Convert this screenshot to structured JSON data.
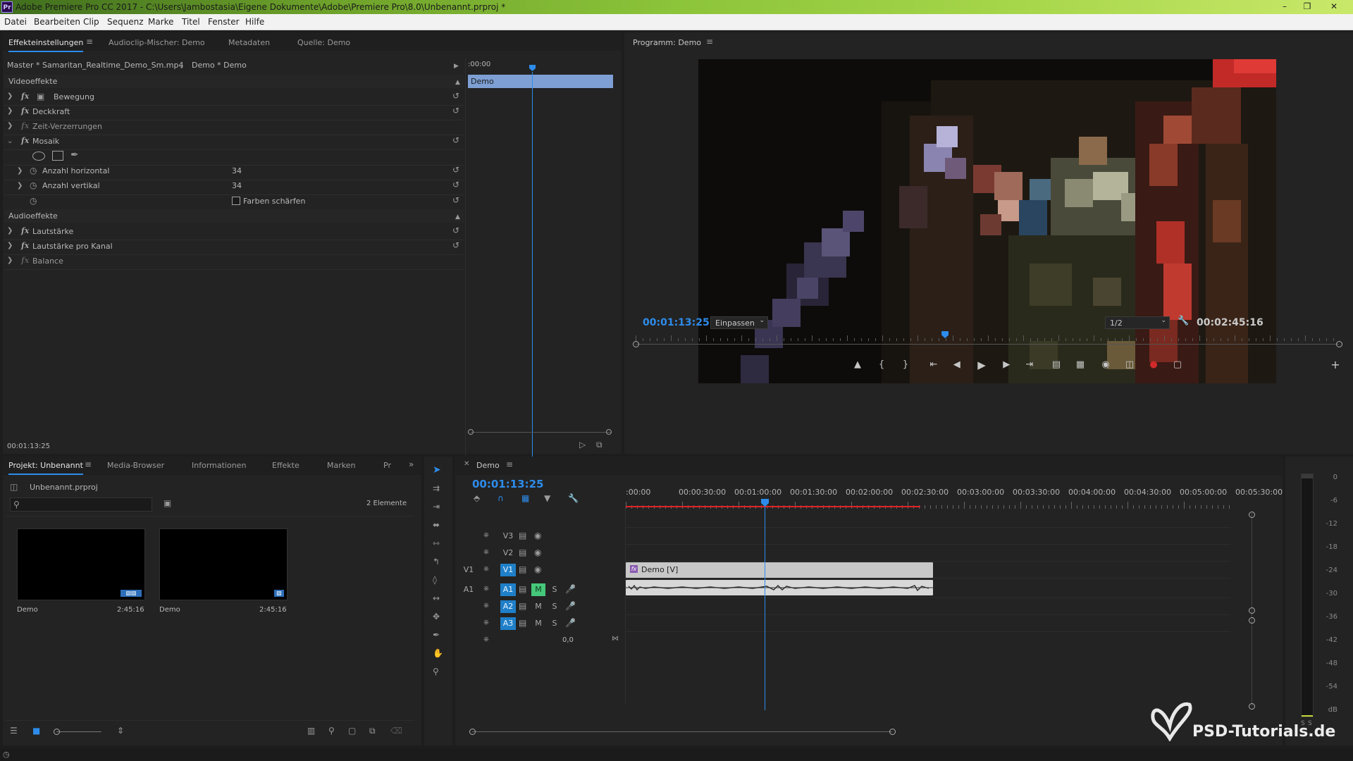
{
  "window": {
    "title": "Adobe Premiere Pro CC 2017 - C:\\Users\\Jambostasia\\Eigene Dokumente\\Adobe\\Premiere Pro\\8.0\\Unbenannt.prproj *",
    "app_logo": "Pr"
  },
  "menu": [
    "Datei",
    "Bearbeiten",
    "Clip",
    "Sequenz",
    "Marke",
    "Titel",
    "Fenster",
    "Hilfe"
  ],
  "effect_panel": {
    "tabs": [
      "Effekteinstellungen",
      "Audioclip-Mischer: Demo",
      "Metadaten",
      "Quelle: Demo"
    ],
    "master_label": "Master * Samaritan_Realtime_Demo_Sm.mp4",
    "sequence_label": "Demo * Demo",
    "mini_timecode": ":00:00",
    "mini_clip": "Demo",
    "video_section": "Videoeffekte",
    "effects": [
      {
        "name": "Bewegung"
      },
      {
        "name": "Deckkraft"
      },
      {
        "name": "Zeit-Verzerrungen"
      },
      {
        "name": "Mosaik"
      }
    ],
    "params": [
      {
        "name": "Anzahl horizontal",
        "value": "34"
      },
      {
        "name": "Anzahl vertikal",
        "value": "34"
      }
    ],
    "checkbox_label": "Farben schärfen",
    "audio_section": "Audioeffekte",
    "audio_effects": [
      {
        "name": "Lautstärke"
      },
      {
        "name": "Lautstärke pro Kanal"
      },
      {
        "name": "Balance"
      }
    ],
    "timecode": "00:01:13:25"
  },
  "program_monitor": {
    "title": "Programm: Demo",
    "timecode": "00:01:13:25",
    "zoom": "Einpassen",
    "resolution": "1/2",
    "duration": "00:02:45:16",
    "playhead_fraction": 0.44
  },
  "project_panel": {
    "tabs": [
      "Projekt: Unbenannt",
      "Media-Browser",
      "Informationen",
      "Effekte",
      "Marken",
      "Pr"
    ],
    "file": "Unbenannt.prproj",
    "item_count": "2 Elemente",
    "items": [
      {
        "name": "Demo",
        "duration": "2:45:16"
      },
      {
        "name": "Demo",
        "duration": "2:45:16"
      }
    ]
  },
  "timeline": {
    "title": "Demo",
    "timecode": "00:01:13:25",
    "ruler": [
      ":00:00",
      "00:00:30:00",
      "00:01:00:00",
      "00:01:30:00",
      "00:02:00:00",
      "00:02:30:00",
      "00:03:00:00",
      "00:03:30:00",
      "00:04:00:00",
      "00:04:30:00",
      "00:05:00:00",
      "00:05:30:00"
    ],
    "video_tracks": [
      "V3",
      "V2",
      "V1"
    ],
    "audio_tracks": [
      "A1",
      "A2",
      "A3"
    ],
    "source_video": "V1",
    "source_audio": "A1",
    "video_clip": "Demo [V]",
    "mute_label": "M",
    "solo_label": "S",
    "master_volume": "0,0"
  },
  "meter": {
    "labels": [
      "0",
      "-6",
      "-12",
      "-18",
      "-24",
      "-30",
      "-36",
      "-42",
      "-48",
      "-54",
      "dB"
    ],
    "bottom": [
      "S",
      "S"
    ]
  },
  "watermark": "PSD-Tutorials.de",
  "colors": {
    "accent": "#2d8ceb",
    "titlebar": "#8cc43a",
    "clip_video": "#c8c8c8",
    "clip_audio": "#d8d8d8",
    "work_area": "#e22222"
  }
}
